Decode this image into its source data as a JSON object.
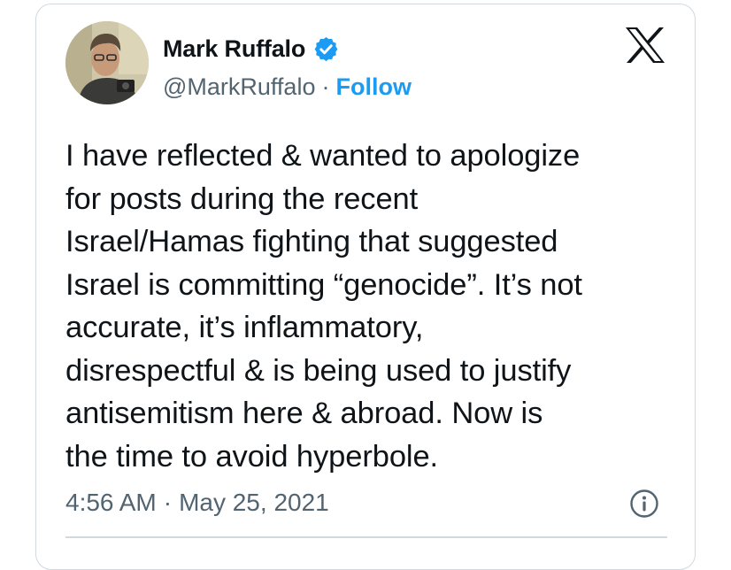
{
  "author": {
    "display_name": "Mark Ruffalo",
    "handle": "@MarkRuffalo",
    "separator": "·",
    "follow_label": "Follow",
    "verified_color": "#1d9bf0"
  },
  "tweet": {
    "text": "I have reflected & wanted to apologize\nfor posts during the recent\nIsrael/Hamas fighting that suggested\nIsrael is committing “genocide”. It’s not\naccurate, it’s inflammatory,\ndisrespectful & is being used to justify\nantisemitism here & abroad. Now is\nthe time to avoid hyperbole."
  },
  "meta": {
    "time": "4:56 AM",
    "separator": "·",
    "date": "May 25, 2021"
  },
  "icons": {
    "brand": "x-logo-icon",
    "verified": "verified-badge-icon",
    "info": "info-icon"
  },
  "colors": {
    "text": "#0f1419",
    "secondary": "#536471",
    "accent": "#1d9bf0",
    "border": "#cfd9de"
  }
}
